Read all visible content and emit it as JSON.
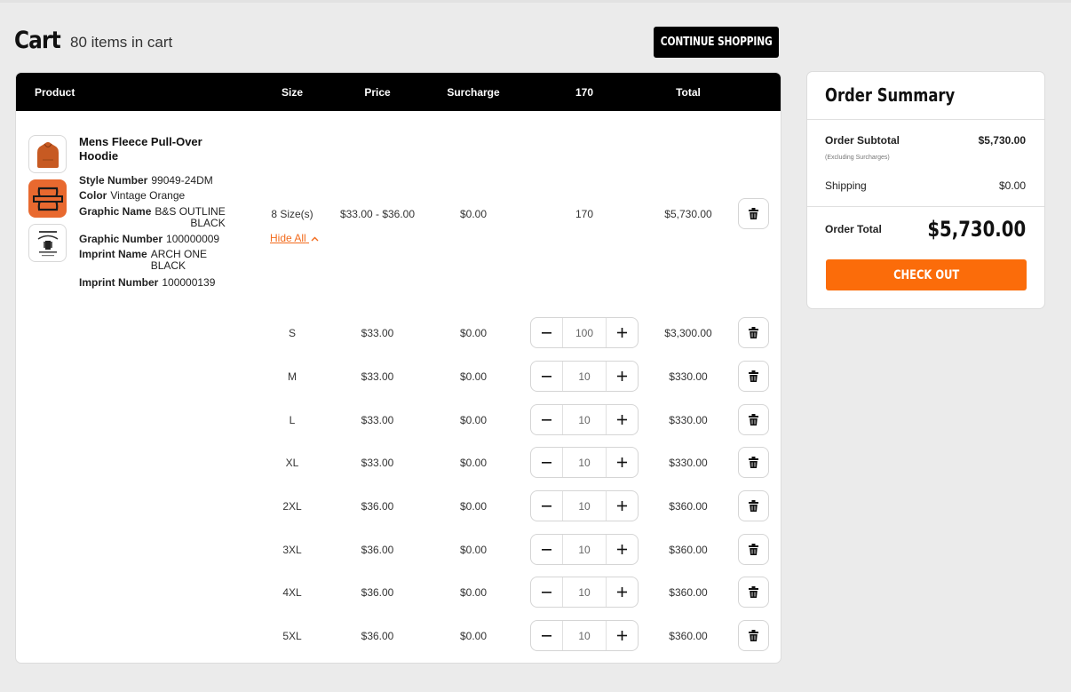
{
  "page": {
    "title": "Cart",
    "items_count": "80 items in cart",
    "continue_label": "CONTINUE SHOPPING"
  },
  "table": {
    "headers": [
      "Product",
      "Size",
      "Price",
      "Surcharge",
      "170",
      "Total"
    ]
  },
  "product": {
    "name": "Mens Fleece Pull-Over Hoodie",
    "attributes": [
      {
        "label": "Style Number",
        "value": "99049-24DM"
      },
      {
        "label": "Color",
        "value": "Vintage Orange"
      },
      {
        "label": "Graphic Name",
        "value": "B&S OUTLINE\nBLACK"
      },
      {
        "label": "Graphic Number",
        "value": "100000009"
      },
      {
        "label": "Imprint Name",
        "value": "ARCH ONE\nBLACK"
      },
      {
        "label": "Imprint Number",
        "value": "100000139"
      }
    ],
    "sizes_summary": "8 Size(s)",
    "price_range": "$33.00 - $36.00",
    "surcharge": "$0.00",
    "quantity": "170",
    "total": "$5,730.00",
    "hide_all_label": "Hide All",
    "thumbnails": [
      "hoodie-thumbnail",
      "bar-and-shield-logo-thumbnail",
      "arch-imprint-thumbnail"
    ]
  },
  "sizes": [
    {
      "size": "S",
      "price": "$33.00",
      "surcharge": "$0.00",
      "qty": "100",
      "total": "$3,300.00"
    },
    {
      "size": "M",
      "price": "$33.00",
      "surcharge": "$0.00",
      "qty": "10",
      "total": "$330.00"
    },
    {
      "size": "L",
      "price": "$33.00",
      "surcharge": "$0.00",
      "qty": "10",
      "total": "$330.00"
    },
    {
      "size": "XL",
      "price": "$33.00",
      "surcharge": "$0.00",
      "qty": "10",
      "total": "$330.00"
    },
    {
      "size": "2XL",
      "price": "$36.00",
      "surcharge": "$0.00",
      "qty": "10",
      "total": "$360.00"
    },
    {
      "size": "3XL",
      "price": "$36.00",
      "surcharge": "$0.00",
      "qty": "10",
      "total": "$360.00"
    },
    {
      "size": "4XL",
      "price": "$36.00",
      "surcharge": "$0.00",
      "qty": "10",
      "total": "$360.00"
    },
    {
      "size": "5XL",
      "price": "$36.00",
      "surcharge": "$0.00",
      "qty": "10",
      "total": "$360.00"
    }
  ],
  "summary": {
    "title": "Order Summary",
    "subtotal_label": "Order Subtotal",
    "subtotal_note": "(Excluding Surcharges)",
    "subtotal_value": "$5,730.00",
    "shipping_label": "Shipping",
    "shipping_value": "$0.00",
    "total_label": "Order Total",
    "total_value": "$5,730.00",
    "checkout_label": "CHECK OUT"
  },
  "colors": {
    "accent": "#fb6c0a",
    "header_bg": "#000000",
    "page_bg": "#ebebeb",
    "hoodie": "#c75a22",
    "logo_tile": "#e8692f"
  },
  "icons": [
    "trash-icon",
    "minus-icon",
    "plus-icon",
    "chevron-up-icon"
  ]
}
